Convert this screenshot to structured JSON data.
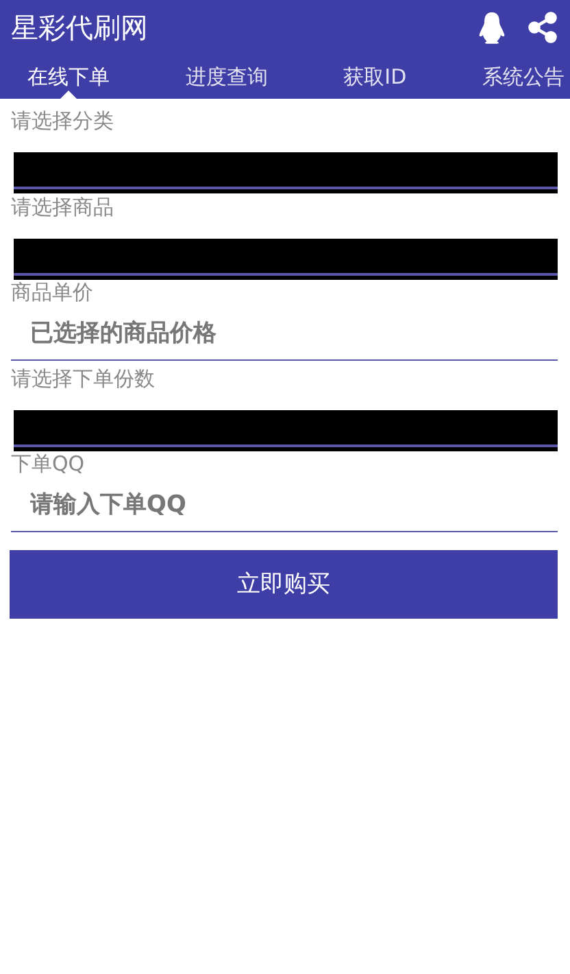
{
  "app_bar": {
    "title": "星彩代刷网"
  },
  "tabs": [
    {
      "label": "在线下单",
      "selected": true
    },
    {
      "label": "进度查询",
      "selected": false
    },
    {
      "label": "获取ID",
      "selected": false
    },
    {
      "label": "系统公告",
      "selected": false
    }
  ],
  "form": [
    {
      "label": "请选择分类",
      "kind": "redacted"
    },
    {
      "label": "请选择商品",
      "kind": "redacted"
    },
    {
      "label": "商品单价",
      "kind": "input",
      "placeholder": "已选择的商品价格"
    },
    {
      "label": "请选择下单份数",
      "kind": "redacted"
    },
    {
      "label": "下单QQ",
      "kind": "input",
      "placeholder": "请输入下单QQ"
    }
  ],
  "submit_button": "立即购买"
}
